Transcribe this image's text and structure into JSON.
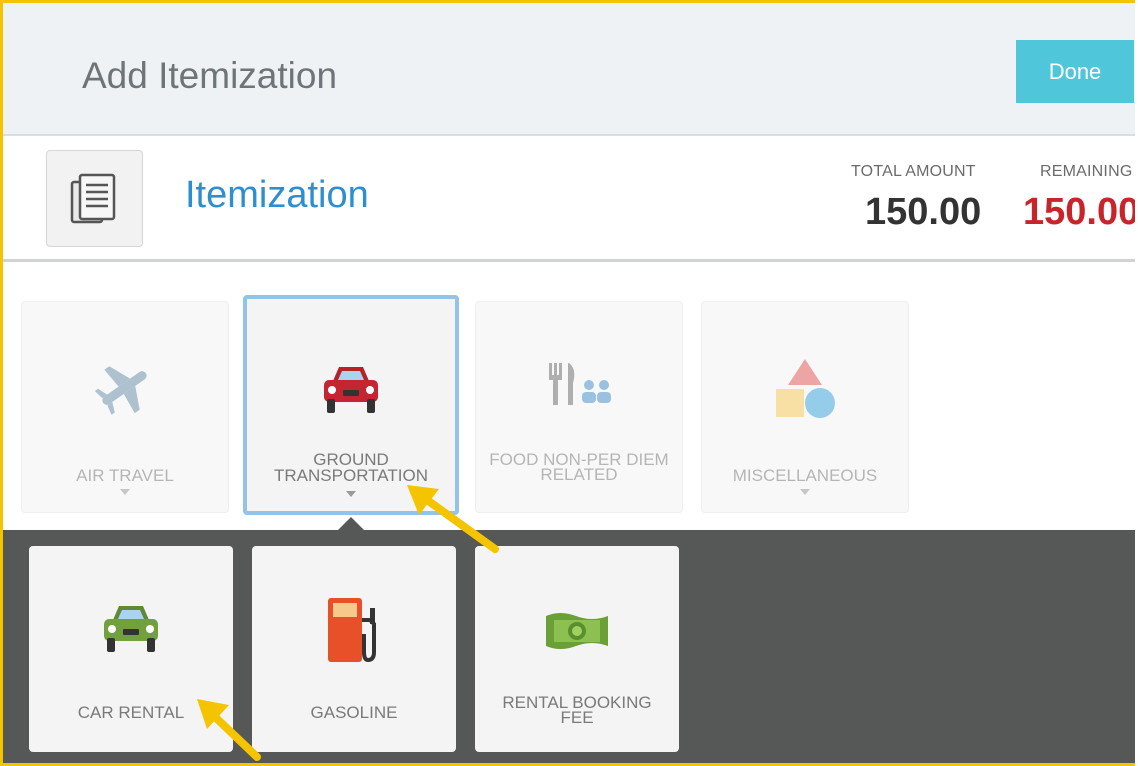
{
  "header": {
    "title": "Add Itemization",
    "done_label": "Done"
  },
  "subheader": {
    "title": "Itemization",
    "total_label": "TOTAL AMOUNT",
    "total_value": "150.00",
    "remaining_label": "REMAINING",
    "remaining_value": "150.00"
  },
  "categories": [
    {
      "label": "AIR TRAVEL",
      "icon": "airplane-icon",
      "state": "dim"
    },
    {
      "label_line1": "GROUND",
      "label_line2": "TRANSPORTATION",
      "icon": "car-icon",
      "state": "selected"
    },
    {
      "label_line1": "FOOD NON-PER DIEM",
      "label_line2": "RELATED",
      "icon": "dining-icon",
      "state": "dim"
    },
    {
      "label": "MISCELLANEOUS",
      "icon": "shapes-icon",
      "state": "dim"
    }
  ],
  "subcategories": [
    {
      "label": "CAR RENTAL",
      "icon": "rental-car-icon"
    },
    {
      "label": "GASOLINE",
      "icon": "gas-pump-icon"
    },
    {
      "label_line1": "RENTAL BOOKING",
      "label_line2": "FEE",
      "icon": "money-icon"
    }
  ],
  "colors": {
    "accent": "#4fc6da",
    "title_blue": "#2d8ed0",
    "remaining_red": "#c8252b",
    "selected_border": "#94c3e8",
    "annotation_arrow": "#f5c400"
  }
}
